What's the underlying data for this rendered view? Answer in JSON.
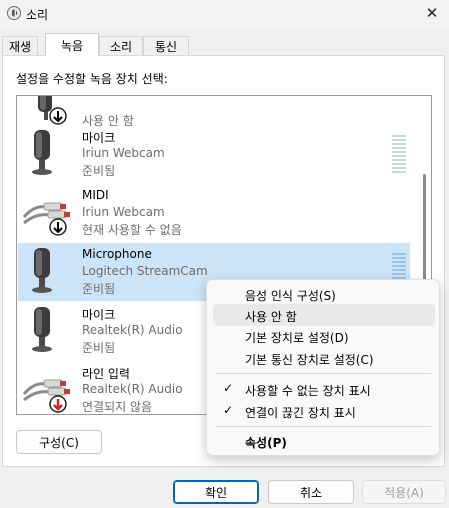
{
  "window": {
    "title": "소리",
    "close_glyph": "✕",
    "icon": "speaker-icon"
  },
  "tabs": [
    {
      "label": "재생",
      "active": false
    },
    {
      "label": "녹음",
      "active": true
    },
    {
      "label": "소리",
      "active": false
    },
    {
      "label": "통신",
      "active": false
    }
  ],
  "instruction": "설정을 수정할 녹음 장치 선택:",
  "devices": [
    {
      "name": "",
      "sub": "",
      "status": "사용 안 함",
      "icon": "stereo-mix-icon",
      "badge": "down-arrow",
      "selected": false
    },
    {
      "name": "마이크",
      "sub": "Iriun Webcam",
      "status": "준비됨",
      "icon": "microphone-icon",
      "badge": "none",
      "selected": false
    },
    {
      "name": "MIDI",
      "sub": "Iriun Webcam",
      "status": "현재 사용할 수 없음",
      "icon": "line-in-icon",
      "badge": "down-arrow",
      "selected": false
    },
    {
      "name": "Microphone",
      "sub": "Logitech StreamCam",
      "status": "준비됨",
      "icon": "microphone-icon",
      "badge": "none",
      "selected": true
    },
    {
      "name": "마이크",
      "sub": "Realtek(R) Audio",
      "status": "준비됨",
      "icon": "microphone-icon",
      "badge": "none",
      "selected": false
    },
    {
      "name": "라인 입력",
      "sub": "Realtek(R) Audio",
      "status": "연결되지 않음",
      "icon": "line-in-icon",
      "badge": "red-down-arrow",
      "selected": false
    }
  ],
  "buttons": {
    "configure": "구성(C)",
    "ok": "확인",
    "cancel": "취소",
    "apply": "적용(A)"
  },
  "context_menu": {
    "items": [
      {
        "label": "음성 인식 구성(S)",
        "checked": false,
        "hover": false,
        "bold": false
      },
      {
        "label": "사용 안 함",
        "checked": false,
        "hover": true,
        "bold": false
      },
      {
        "label": "기본 장치로 설정(D)",
        "checked": false,
        "hover": false,
        "bold": false
      },
      {
        "label": "기본 통신 장치로 설정(C)",
        "checked": false,
        "hover": false,
        "bold": false
      },
      {
        "label": "사용할 수 없는 장치 표시",
        "checked": true,
        "hover": false,
        "bold": false
      },
      {
        "label": "연결이 끊긴 장치 표시",
        "checked": true,
        "hover": false,
        "bold": false
      },
      {
        "label": "속성(P)",
        "checked": false,
        "hover": false,
        "bold": true
      }
    ],
    "check_glyph": "✓"
  },
  "colors": {
    "selection": "#cce4f7",
    "accent": "#0067c0",
    "disconnected": "#d21f1f"
  }
}
